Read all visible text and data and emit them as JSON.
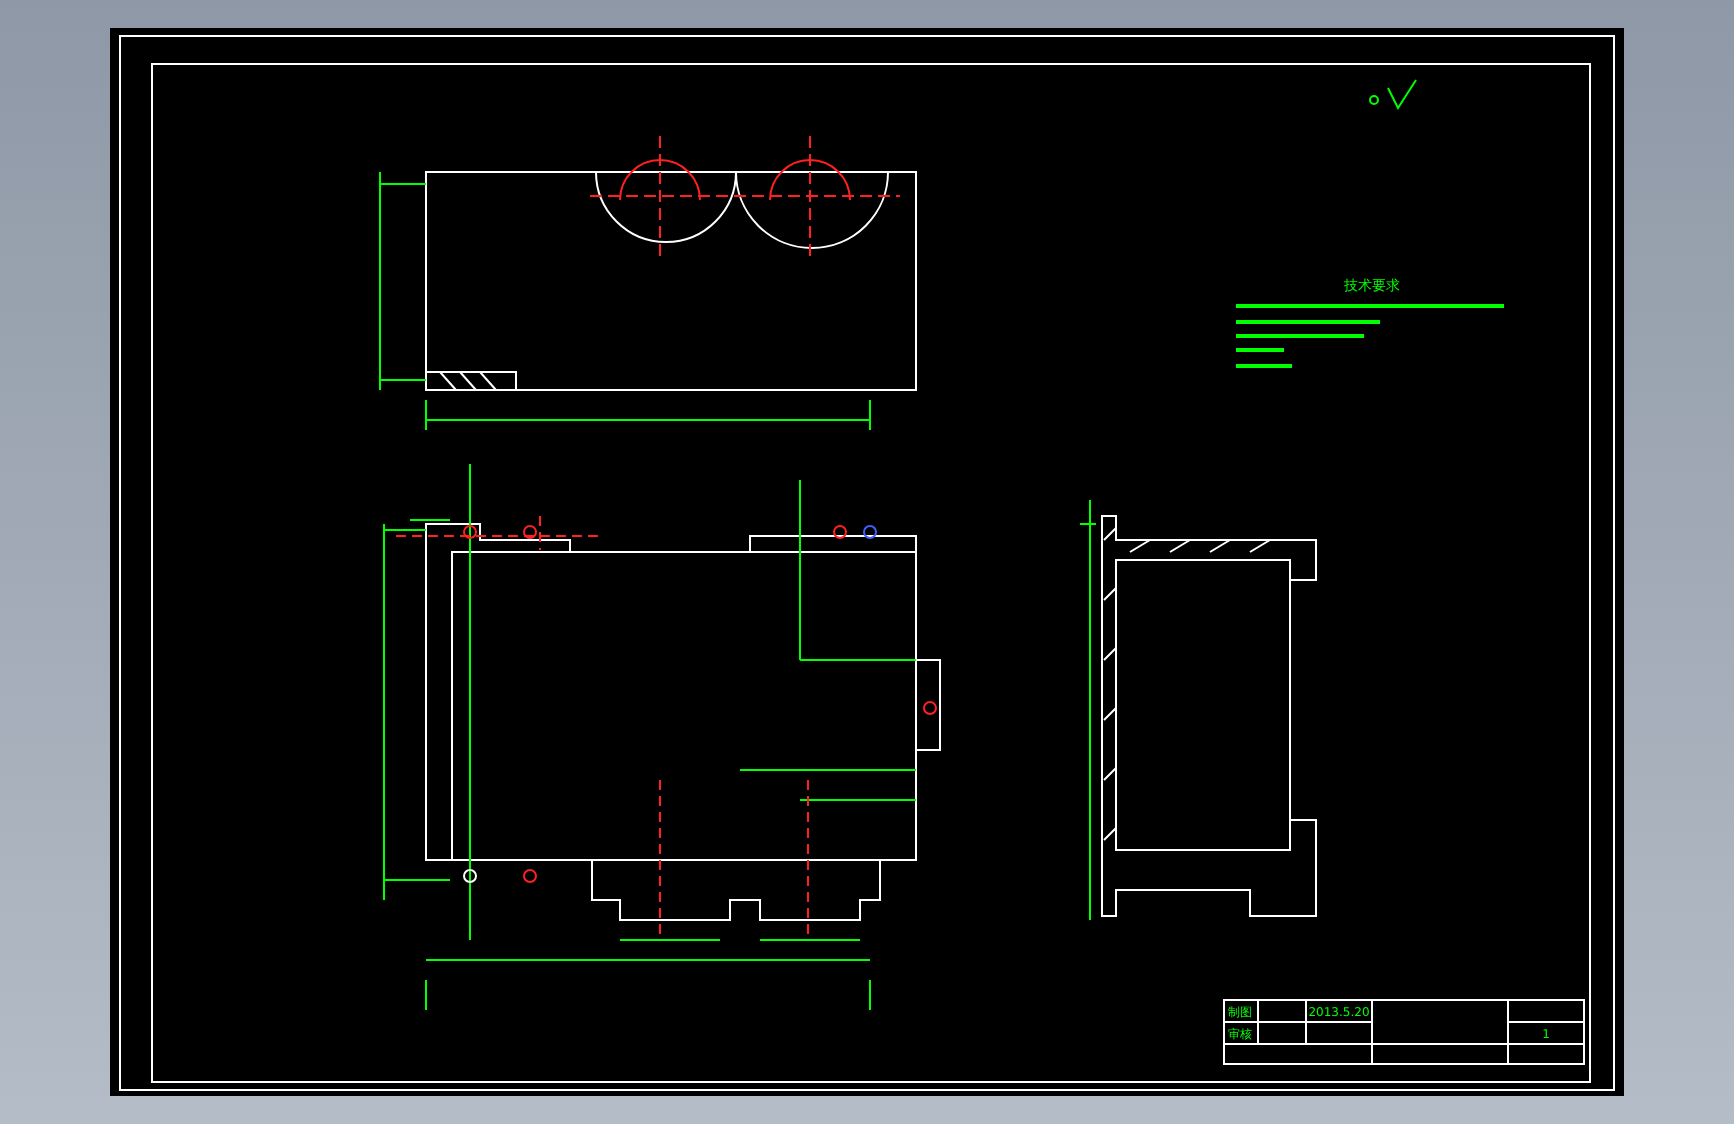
{
  "drawing": {
    "technical_requirements": {
      "heading": "技术要求"
    },
    "title_block": {
      "labels": [
        "制图",
        "审核"
      ],
      "date": "2013.5.20",
      "scale": "1"
    }
  }
}
